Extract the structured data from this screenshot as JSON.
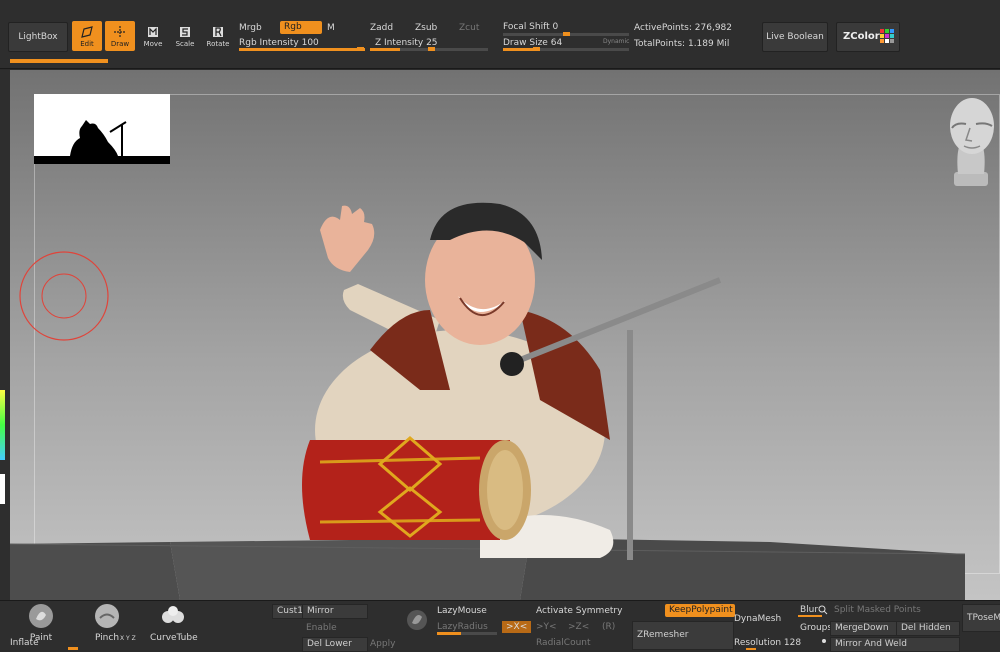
{
  "topbar": {
    "lightbox": "LightBox",
    "tools": [
      {
        "name": "edit",
        "label": "Edit",
        "active": true
      },
      {
        "name": "draw",
        "label": "Draw",
        "active": true
      },
      {
        "name": "move",
        "label": "Move",
        "active": false
      },
      {
        "name": "scale",
        "label": "Scale",
        "active": false
      },
      {
        "name": "rotate",
        "label": "Rotate",
        "active": false
      }
    ],
    "mrgb": "Mrgb",
    "rgb": "Rgb",
    "m": "M",
    "rgb_intensity_label": "Rgb Intensity",
    "rgb_intensity_value": "100",
    "zadd": "Zadd",
    "zsub": "Zsub",
    "zcut": "Zcut",
    "z_intensity_label": "Z Intensity",
    "z_intensity_value": "25",
    "focal_shift_label": "Focal Shift",
    "focal_shift_value": "0",
    "draw_size_label": "Draw Size",
    "draw_size_value": "64",
    "dynamic": "Dynamic",
    "active_points_label": "ActivePoints:",
    "active_points_value": "276,982",
    "total_points_label": "TotalPoints:",
    "total_points_value": "1.189 Mil",
    "live_boolean": "Live Boolean",
    "zcolor": "ZColor"
  },
  "bottombar": {
    "paint": "Paint",
    "pinch": "Pinch",
    "curvetube": "CurveTube",
    "inflate": "Inflate",
    "xyz": "X Y Z",
    "cust1": "Cust1",
    "mirror": "Mirror",
    "enable": "Enable",
    "del_lower": "Del Lower",
    "apply": "Apply",
    "lazymouse": "LazyMouse",
    "lazyradius": "LazyRadius",
    "activate_symmetry": "Activate Symmetry",
    "sym_x": ">X<",
    "sym_y": ">Y<",
    "sym_z": ">Z<",
    "sym_r": "(R)",
    "radialcount": "RadialCount",
    "keeppolypaint": "KeepPolypaint",
    "zremesher": "ZRemesher",
    "dynamesh": "DynaMesh",
    "resolution_label": "Resolution",
    "resolution_value": "128",
    "blur": "Blur",
    "groups": "Groups",
    "split_masked_points": "Split Masked Points",
    "mergedown": "MergeDown",
    "del_hidden": "Del Hidden",
    "mirror_and_weld": "Mirror And Weld",
    "tposeme": "TPoseMe"
  },
  "colors": {
    "accent": "#f0901e",
    "panel": "#2e2e2e",
    "cursor_ring": "#e0443a"
  }
}
